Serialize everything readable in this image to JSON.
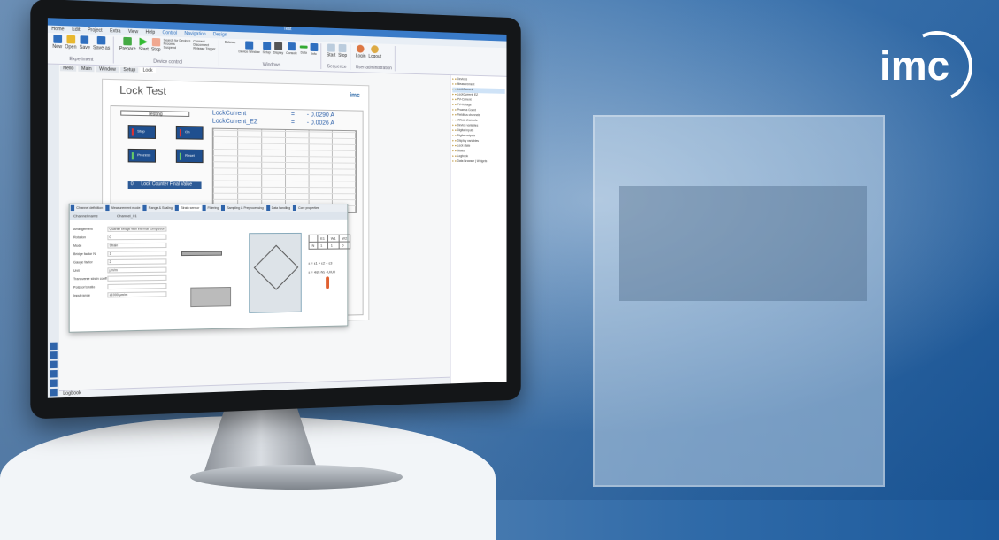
{
  "brand": {
    "logo_text": "imc"
  },
  "app": {
    "title_tab": "Test",
    "menu": [
      "Home",
      "Edit",
      "Project",
      "Extra",
      "View",
      "Help",
      "Control",
      "Navigation",
      "Design"
    ],
    "ribbon_groups": [
      {
        "label": "Experiment",
        "buttons": [
          "New",
          "Open",
          "Save",
          "Save as"
        ]
      },
      {
        "label": "Device control",
        "buttons": [
          "Prepare",
          "Start",
          "Stop",
          "Search for Devices",
          "Connect",
          "Process",
          "Disconnect",
          "Suspend",
          "Release Trigger"
        ]
      },
      {
        "label": "Windows",
        "buttons": [
          "Balance",
          "Device Window",
          "Setup",
          "Display",
          "Console",
          "Data",
          "Info"
        ]
      },
      {
        "label": "Sequence",
        "buttons": [
          "Start",
          "Stop"
        ]
      },
      {
        "label": "User administration",
        "buttons": [
          "Login",
          "Logout"
        ]
      }
    ],
    "panel_tabs": [
      "Hello",
      "Main",
      "Window",
      "Setup",
      "Lock"
    ],
    "page": {
      "title": "Lock Test",
      "logo": "imc",
      "status_field": "Testing",
      "buttons": [
        "Stop",
        "On",
        "Prozess",
        "Reset"
      ],
      "counter_label": "Lock Counter Final Value",
      "counter_value": "0",
      "readouts": [
        {
          "name": "LockCurrent",
          "eq": "=",
          "value": "- 0.0290 A"
        },
        {
          "name": "LockCurrent_EZ",
          "eq": "=",
          "value": "- 0.0026 A"
        }
      ]
    },
    "dialog": {
      "tabs": [
        "Channel definition",
        "Measurement mode",
        "Range & Scaling",
        "Strain sensor",
        "Filtering",
        "Sampling & Preprocessing",
        "Data handling",
        "Core properties"
      ],
      "channel_name_label": "Channel name",
      "channel_name": "Channel_01",
      "fields": [
        {
          "label": "Arrangement",
          "value": "Quarter bridge with internal completion"
        },
        {
          "label": "Rotation",
          "value": "0"
        },
        {
          "label": "Mode",
          "value": "Strain"
        },
        {
          "label": "Bridge factor N",
          "value": "1"
        },
        {
          "label": "Gauge factor",
          "value": "2"
        },
        {
          "label": "Unit",
          "value": "µm/m"
        },
        {
          "label": "Transverse strain coeff",
          "value": ""
        },
        {
          "label": "Poisson's ratio",
          "value": ""
        },
        {
          "label": "Input range",
          "value": "±1000 µm/m"
        }
      ],
      "table_head": [
        "E1",
        "W1",
        "W2"
      ],
      "table_row": [
        "N",
        "1",
        "1",
        "0"
      ],
      "eq1": "ε = ε1 + ε2 + ε3",
      "eq2": "ε = 4/(k·N) · U/U0"
    },
    "tree_items": [
      "Devices",
      "Measurement",
      "LockCurrent",
      "LockCurrent_EZ",
      "PV-Current",
      "PV-Voltage",
      "Prozess Count",
      "Fieldbus channels",
      "Virtual channels",
      "Device variables",
      "Digital inputs",
      "Digital outputs",
      "Display variables",
      "Lock state",
      "Status",
      "Logbook"
    ],
    "tree_tabs": [
      "Data Browser",
      "Widgets"
    ],
    "logbook": "Logbook"
  }
}
